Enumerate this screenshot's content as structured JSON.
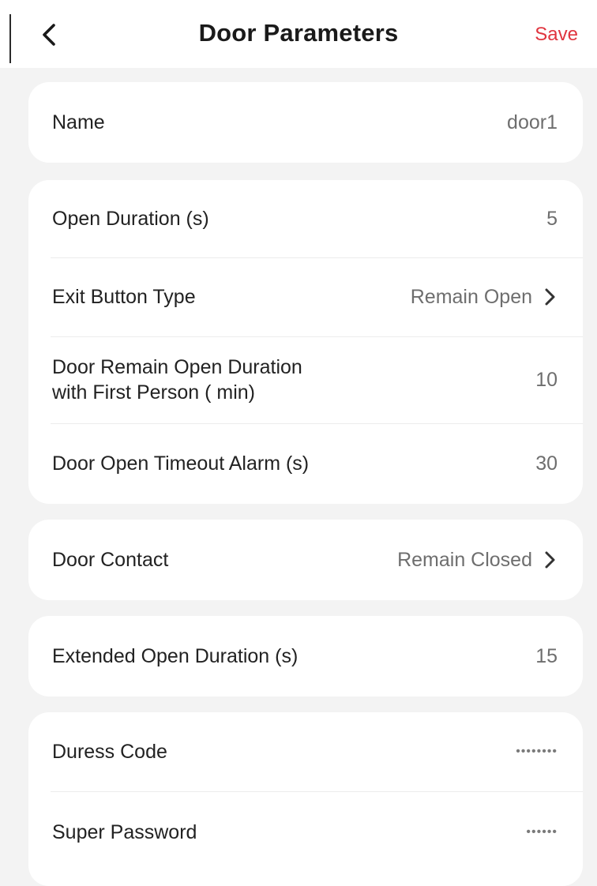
{
  "header": {
    "back_icon": "chevron-left-icon",
    "title": "Door Parameters",
    "save_label": "Save",
    "save_color": "#e0353f"
  },
  "groups": {
    "name": {
      "label": "Name",
      "value": "door1"
    },
    "timing": {
      "open_duration": {
        "label": "Open Duration (s)",
        "value": "5"
      },
      "exit_button_type": {
        "label": "Exit Button Type",
        "value": "Remain Open"
      },
      "first_person": {
        "label_line1": "Door Remain Open Duration",
        "label_line2": "with First Person ( min)",
        "value": "10"
      },
      "timeout_alarm": {
        "label": "Door Open Timeout Alarm (s)",
        "value": "30"
      }
    },
    "contact": {
      "label": "Door Contact",
      "value": "Remain Closed"
    },
    "extended": {
      "label": "Extended Open Duration (s)",
      "value": "15"
    },
    "security": {
      "duress_code": {
        "label": "Duress Code",
        "value": "••••••••"
      },
      "super_password": {
        "label": "Super Password",
        "value": "••••••"
      }
    }
  }
}
